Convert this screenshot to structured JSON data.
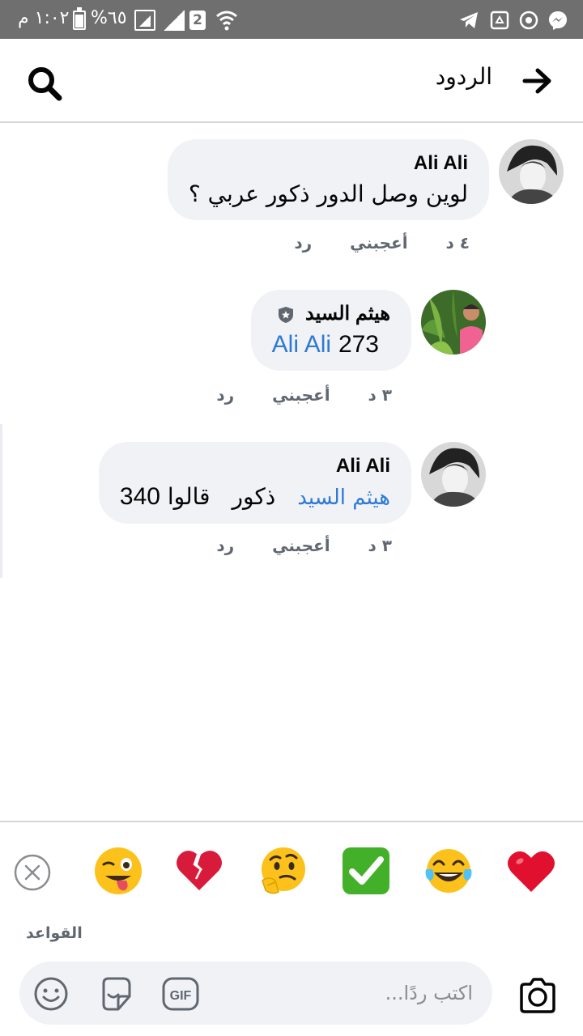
{
  "status_bar": {
    "time": "١:٠٢ م",
    "battery": "%٦٥",
    "sim_label": "2",
    "icons": [
      "telegram-icon",
      "recycle-icon",
      "power-icon",
      "messenger-icon"
    ]
  },
  "header": {
    "title": "الردود",
    "back_icon": "arrow-right-icon",
    "search_icon": "search-icon"
  },
  "comments": [
    {
      "author": "Ali Ali",
      "text": "لوين وصل الدور ذكور عربي ؟",
      "time": "٤ د",
      "like_label": "أعجبني",
      "reply_label": "رد"
    },
    {
      "author": "هيثم السيد",
      "badge_icon": "shield-star-icon",
      "mention": "Ali Ali",
      "text": "273",
      "time": "٣ د",
      "like_label": "أعجبني",
      "reply_label": "رد"
    },
    {
      "author": "Ali Ali",
      "mention": "هيثم السيد",
      "text_word": "ذكور",
      "text_word2": "قالوا",
      "number": "340",
      "time": "٣ د",
      "like_label": "أعجبني",
      "reply_label": "رد"
    }
  ],
  "reactions": [
    "heart-icon",
    "tears-of-joy-icon",
    "check-mark-icon",
    "thinking-face-icon",
    "broken-heart-icon",
    "winking-tongue-icon"
  ],
  "rules_label": "القواعد",
  "composer": {
    "placeholder": "اكتب ردًا...",
    "icons": [
      "gif-icon",
      "sticker-icon",
      "emoji-icon",
      "camera-icon"
    ],
    "gif_label": "GIF"
  }
}
